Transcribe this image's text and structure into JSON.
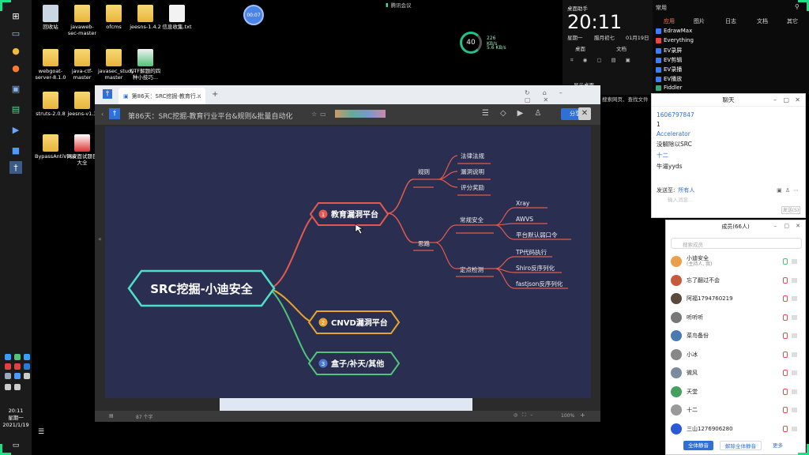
{
  "desktop": {
    "icons": [
      {
        "label": "回收站"
      },
      {
        "label": "javaweb-sec-master"
      },
      {
        "label": "ofcms"
      },
      {
        "label": "jeesns-1.4.2"
      },
      {
        "label": "信息收集.txt"
      },
      {
        "label": "webgoat-server-8.1.0"
      },
      {
        "label": "java-ctf-master"
      },
      {
        "label": "javasec_study-master"
      },
      {
        "label": "CTF解题的四种小技巧..."
      },
      {
        "label": "struts-2.0.8"
      },
      {
        "label": "jeesns-v1.3"
      },
      {
        "label": "BypassAntiVirus"
      },
      {
        "label": "网安面试题目大全"
      }
    ]
  },
  "timer_badge": "00:07",
  "meeting_pill": "腾讯会议",
  "speed": {
    "percent": "40",
    "up": "226 KB/s",
    "down": "5.6 KB/s"
  },
  "clock": {
    "header": "桌面助手",
    "time": "20:11",
    "weekday": "星期一",
    "lunar": "腊月初七",
    "date": "01月19日",
    "items": [
      "桌面",
      "文档",
      "显示桌面",
      "文件"
    ],
    "search_hint": "搜索网页、查找文件"
  },
  "right_menu": {
    "title": "常用",
    "tabs": [
      "应用",
      "图片",
      "日志",
      "文档",
      "其它"
    ],
    "apps": [
      "EdrawMax",
      "Everything",
      "EV录屏",
      "EV剪辑",
      "EV录播",
      "EV播放",
      "Fiddler"
    ]
  },
  "chat": {
    "title": "聊天",
    "messages": [
      "1606797847",
      "1",
      "Accelerator",
      "没解除以SRC",
      "十二",
      "牛逼yyds"
    ],
    "send_to_label": "发送至:",
    "send_to_value": "所有人",
    "input_placeholder": "输入消息...",
    "send_button": "发送(S)"
  },
  "members": {
    "title": "成员(66人)",
    "search_placeholder": "搜索成员",
    "list": [
      {
        "name": "小迪安全",
        "sub": "(主持人, 我)",
        "color": "#e8a04a"
      },
      {
        "name": "忘了翻过不会",
        "sub": "",
        "color": "#c85a3c"
      },
      {
        "name": "阿福1794760219",
        "sub": "",
        "color": "#5a4a3c"
      },
      {
        "name": "听听听",
        "sub": "",
        "color": "#777777"
      },
      {
        "name": "菜鸟备份",
        "sub": "",
        "color": "#4a7ab0"
      },
      {
        "name": "小冰",
        "sub": "",
        "color": "#888888"
      },
      {
        "name": "微风",
        "sub": "",
        "color": "#7a8aa0"
      },
      {
        "name": "天堂",
        "sub": "",
        "color": "#44a060"
      },
      {
        "name": "十二",
        "sub": "",
        "color": "#999999"
      },
      {
        "name": "三山1276906280",
        "sub": "",
        "color": "#2a5ad6"
      }
    ],
    "btn_mute_all": "全体静音",
    "btn_unmute_all": "解除全体静音",
    "btn_more": "更多"
  },
  "browser": {
    "tab_title": "第86天：SRC挖掘-教育行...",
    "doc_title": "第86天：SRC挖掘-教育行业平台&规则&批量自动化",
    "share_label": "分享",
    "status_left": "87 个字",
    "zoom": "100%"
  },
  "mindmap": {
    "root": "SRC挖掘-小迪安全",
    "branches": [
      {
        "num": "1",
        "label": "教育漏洞平台",
        "color": "#e05a4e"
      },
      {
        "num": "2",
        "label": "CNVD漏洞平台",
        "color": "#e6a52c"
      },
      {
        "num": "3",
        "label": "盒子/补天/其他",
        "color": "#4fc47a"
      }
    ],
    "sub1": {
      "label": "规则",
      "children": [
        "法律法规",
        "漏洞说明",
        "评分奖励"
      ]
    },
    "sub2": {
      "label": "思路",
      "groups": [
        {
          "label": "常规安全",
          "children": [
            "Xray",
            "AWVS",
            "平台默认弱口令"
          ]
        },
        {
          "label": "定点检测",
          "children": [
            "TP代码执行",
            "Shiro反序列化",
            "fastjson反序列化"
          ]
        }
      ]
    }
  },
  "taskbar": {
    "time": "20:11",
    "weekday": "星期一",
    "date": "2021/1/19"
  }
}
